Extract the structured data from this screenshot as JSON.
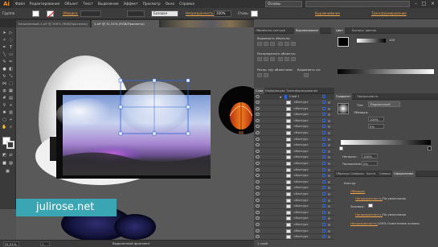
{
  "app": {
    "logo": "Ai",
    "menus": [
      "Файл",
      "Редактирование",
      "Объект",
      "Текст",
      "Выделение",
      "Эффект",
      "Просмотр",
      "Окно",
      "Справка"
    ],
    "workspace": "Основы",
    "window_buttons": [
      "–",
      "□",
      "×"
    ]
  },
  "control_bar": {
    "selection_label": "Группа",
    "stroke_label": "Обводка:",
    "stroke_preset": "Базовая",
    "opacity_label": "Непрозрачность:",
    "opacity_value": "100%",
    "style_label": "Стиль:",
    "align_link": "Выравнивание",
    "transform_link": "Трансформирование"
  },
  "doc_tabs": [
    {
      "label": "Безымянный-1.ai* @ 300% (RGB/Просмотр)",
      "active": false
    },
    {
      "label": "1.ai* @ 31,51% (RGB/Просмотр)",
      "active": true
    }
  ],
  "panels": {
    "top_tabs": [
      "Обработка контура",
      "Выравнивание"
    ],
    "align_objects": "Выровнять объекты:",
    "distribute_objects": "Распределить объекты:",
    "distribute_spacing": "Распр. м/у объектами:",
    "align_to": "Выровнять по:",
    "color_tabs": [
      "Цвет",
      "Каталог цветов"
    ],
    "opacity_label": "Непрозрачность",
    "opacity_value": "100",
    "layers_tabs": [
      "Слои",
      "Информация",
      "Трансформирование"
    ],
    "layer_top": "Слой 1",
    "gradient_tabs": [
      "Градиент",
      "Прозрачность"
    ],
    "gradient_type_label": "Тип:",
    "gradient_type": "Радиальный",
    "gradient_stroke_label": "Обводка:",
    "gradient_zoom": "100%",
    "gradient_angle": "0%",
    "gradient_opacity_label": "Непрозр.:",
    "gradient_opacity": "100%",
    "gradient_position_label": "Положение:",
    "gradient_position": "0%",
    "appearance_tabs": [
      "Образцы",
      "Символы",
      "Кисти",
      "Символ",
      "Оформление"
    ],
    "appearance_title": "Контур",
    "appearance_stroke_label": "Обводка:",
    "appearance_fill_label": "Заливка:",
    "appearance_opacity_label": "Непрозрачность:",
    "appearance_opacity_default": "По умолчанию",
    "appearance_opacity_last": "100% Осветление основы"
  },
  "layers": [
    "<Контур>",
    "<Контур>",
    "<Контур>",
    "<Контур>",
    "<Контур>",
    "<Контур>",
    "<Контур>",
    "<Контур>",
    "<Контур>",
    "<Контур>",
    "<Контур>",
    "<Контур>",
    "<Контур>",
    "<Контур>",
    "<Контур>",
    "<Контур>",
    "<Контур>",
    "<Контур>",
    "<Контур>",
    "<Контур>",
    "<Контур>",
    "<Контур>",
    "<Контур>"
  ],
  "layers_footer": "1 слой",
  "status": {
    "zoom": "31,51%",
    "page": "1",
    "mode": "Выделенный фрагмент"
  },
  "watermark": "julirose.net",
  "colors": {
    "accent_orange": "#f0a64b",
    "selection_blue": "#2d66d6",
    "watermark_bg": "#3aa6b3"
  }
}
